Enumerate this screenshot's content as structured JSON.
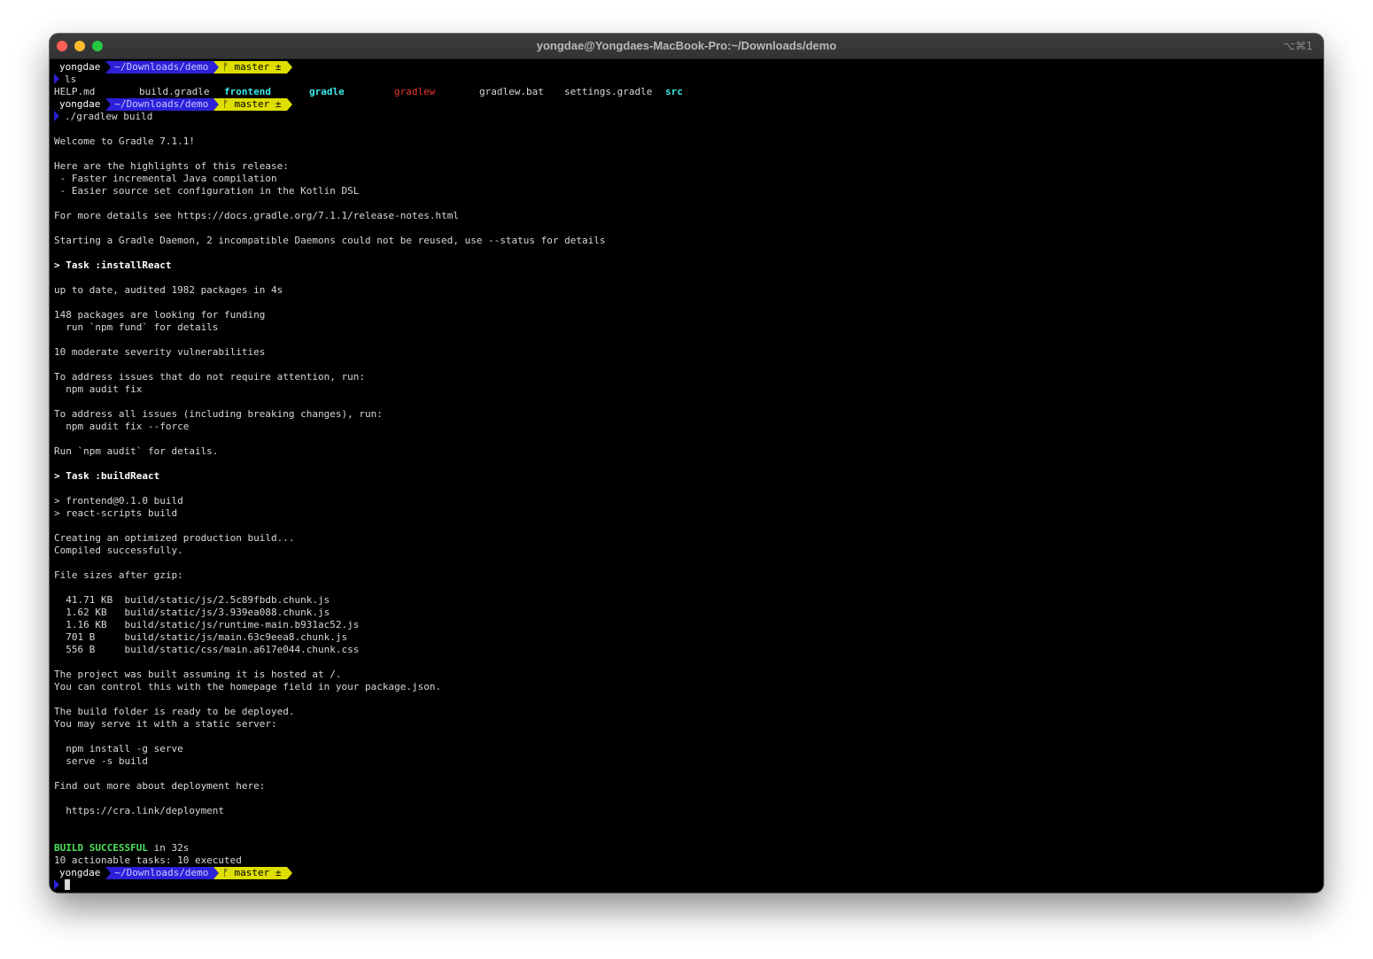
{
  "window": {
    "title": "yongdae@Yongdaes-MacBook-Pro:~/Downloads/demo",
    "shortcut": "⌥⌘1"
  },
  "prompt": {
    "user": "yongdae",
    "path": "~/Downloads/demo",
    "git": "ᚠ master ±"
  },
  "commands": {
    "ls": "ls",
    "build": "./gradlew build"
  },
  "ls_output": [
    {
      "name": "HELP.md",
      "kind": "file"
    },
    {
      "name": "build.gradle",
      "kind": "file"
    },
    {
      "name": "frontend",
      "kind": "dir"
    },
    {
      "name": "gradle",
      "kind": "dir"
    },
    {
      "name": "gradlew",
      "kind": "exec"
    },
    {
      "name": "gradlew.bat",
      "kind": "file"
    },
    {
      "name": "settings.gradle",
      "kind": "file"
    },
    {
      "name": "src",
      "kind": "dir"
    }
  ],
  "output": {
    "welcome": "Welcome to Gradle 7.1.1!",
    "highlights_intro": "Here are the highlights of this release:",
    "highlight_1": " - Faster incremental Java compilation",
    "highlight_2": " - Easier source set configuration in the Kotlin DSL",
    "details": "For more details see https://docs.gradle.org/7.1.1/release-notes.html",
    "daemon": "Starting a Gradle Daemon, 2 incompatible Daemons could not be reused, use --status for details",
    "task_install": "> Task :installReact",
    "up_to_date": "up to date, audited 1982 packages in 4s",
    "funding": "148 packages are looking for funding",
    "funding_run": "  run `npm fund` for details",
    "vulns": "10 moderate severity vulnerabilities",
    "address_1": "To address issues that do not require attention, run:",
    "address_1_cmd": "  npm audit fix",
    "address_2": "To address all issues (including breaking changes), run:",
    "address_2_cmd": "  npm audit fix --force",
    "audit": "Run `npm audit` for details.",
    "task_build": "> Task :buildReact",
    "fe_build": "> frontend@0.1.0 build",
    "rs_build": "> react-scripts build",
    "creating": "Creating an optimized production build...",
    "compiled": "Compiled successfully.",
    "sizes_title": "File sizes after gzip:",
    "sizes": [
      "  41.71 KB  build/static/js/2.5c89fbdb.chunk.js",
      "  1.62 KB   build/static/js/3.939ea088.chunk.js",
      "  1.16 KB   build/static/js/runtime-main.b931ac52.js",
      "  701 B     build/static/js/main.63c9eea8.chunk.js",
      "  556 B     build/static/css/main.a617e044.chunk.css"
    ],
    "hosted": "The project was built assuming it is hosted at /.",
    "homepage": "You can control this with the homepage field in your package.json.",
    "ready": "The build folder is ready to be deployed.",
    "serve_intro": "You may serve it with a static server:",
    "serve_1": "  npm install -g serve",
    "serve_2": "  serve -s build",
    "find_out": "Find out more about deployment here:",
    "deploy_link": "  https://cra.link/deployment",
    "build_success": "BUILD SUCCESSFUL",
    "build_time": " in 32s",
    "tasks": "10 actionable tasks: 10 executed"
  },
  "colors": {
    "background": "#000000",
    "text": "#d8d8d8",
    "path_segment": "#2c20d9",
    "git_segment": "#dede00",
    "dir": "#3ee8e8",
    "exec": "#e8342c",
    "success": "#4ee25a"
  }
}
